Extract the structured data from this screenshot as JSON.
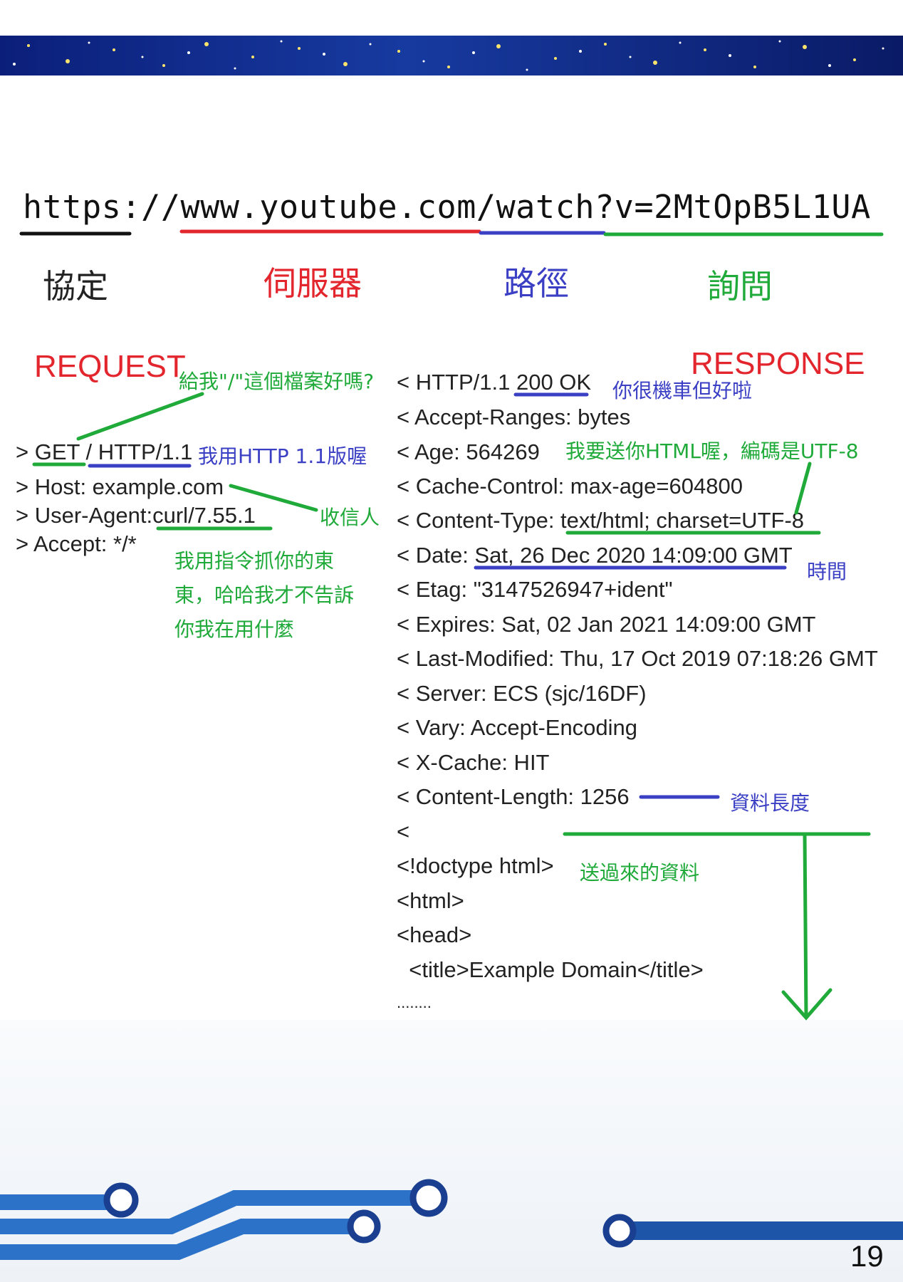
{
  "url": "https://www.youtube.com/watch?v=2MtOpB5L1UA",
  "url_parts": {
    "protocol": "協定",
    "server": "伺服器",
    "path": "路徑",
    "query": "詢問"
  },
  "request": {
    "title": "REQUEST",
    "lines": [
      "> GET / HTTP/1.1",
      "> Host: example.com",
      "> User-Agent:curl/7.55.1",
      "> Accept: */*"
    ],
    "annotations": {
      "ask_file": "給我\"/\"這個檔案好嗎?",
      "http_version": "我用HTTP 1.1版喔",
      "receiver": "收信人",
      "agent_1": "我用指令抓你的東",
      "agent_2": "東，哈哈我才不告訴",
      "agent_3": "你我在用什麼"
    }
  },
  "response": {
    "title": "RESPONSE",
    "lines": [
      "< HTTP/1.1 200 OK",
      "< Accept-Ranges: bytes",
      "< Age: 564269",
      "< Cache-Control: max-age=604800",
      "< Content-Type: text/html; charset=UTF-8",
      "< Date: Sat, 26 Dec 2020 14:09:00 GMT",
      "< Etag: \"3147526947+ident\"",
      "< Expires: Sat, 02 Jan 2021 14:09:00 GMT",
      "< Last-Modified: Thu, 17 Oct 2019 07:18:26 GMT",
      "< Server: ECS (sjc/16DF)",
      "< Vary: Accept-Encoding",
      "< X-Cache: HIT",
      "< Content-Length: 1256",
      "<",
      "<!doctype html>",
      "<html>",
      "<head>",
      "  <title>Example Domain</title>",
      "........"
    ],
    "annotations": {
      "ok": "你很機車但好啦",
      "content_type": "我要送你HTML喔，編碼是UTF-8",
      "time": "時間",
      "length": "資料長度",
      "data": "送過來的資料"
    }
  },
  "page_number": "19",
  "colors": {
    "red": "#e3262d",
    "blue": "#3a3fc4",
    "green": "#1faa3a",
    "banner": "#173aa0"
  }
}
